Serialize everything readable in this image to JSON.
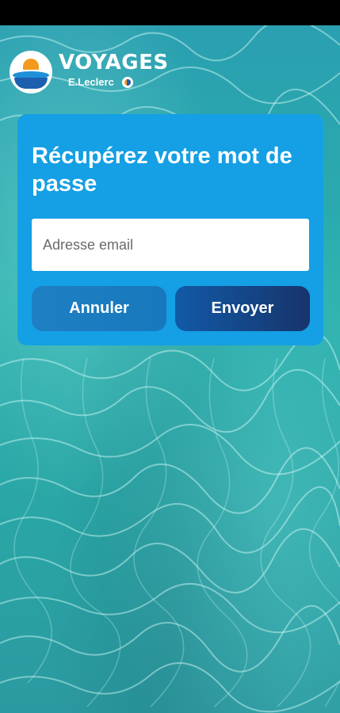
{
  "brand": {
    "title": "VOYAGES",
    "subtitle": "E.Leclerc",
    "logo_icon": "voyages-logo-icon"
  },
  "form": {
    "title": "Récupérez votre mot de passe",
    "email_placeholder": "Adresse email",
    "email_value": "",
    "cancel_label": "Annuler",
    "send_label": "Envoyer"
  },
  "colors": {
    "card": "#159fe4",
    "cancel_button": "#1878bd",
    "send_button_start": "#125aa6",
    "send_button_end": "#17346c",
    "background": "#2aa3a8"
  }
}
